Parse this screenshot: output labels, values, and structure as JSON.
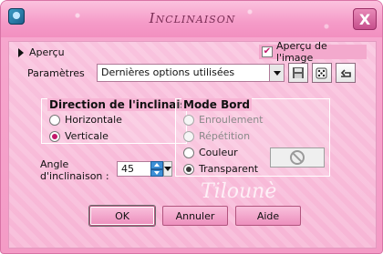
{
  "window": {
    "title": "Inclinaison",
    "close_label": "X"
  },
  "preview": {
    "toggle_label": "Aperçu",
    "checkbox_label": "Aperçu de l'image",
    "checkbox_checked": true
  },
  "parameters": {
    "label": "Paramètres",
    "preset_value": "Dernières options utilisées",
    "buttons": [
      "save-preset-icon",
      "dice-random-icon",
      "reset-icon"
    ]
  },
  "direction": {
    "title": "Direction de l'inclinais",
    "options": [
      {
        "label": "Horizontale",
        "selected": false
      },
      {
        "label": "Verticale",
        "selected": true
      }
    ]
  },
  "edge_mode": {
    "title": "Mode Bord",
    "options": [
      {
        "label": "Enroulement",
        "selected": false,
        "enabled": false
      },
      {
        "label": "Répétition",
        "selected": false,
        "enabled": false
      },
      {
        "label": "Couleur",
        "selected": false,
        "enabled": true
      },
      {
        "label": "Transparent",
        "selected": true,
        "enabled": true
      }
    ]
  },
  "angle": {
    "label_line1": "Angle",
    "label_line2": "d'inclinaison :",
    "value": "45"
  },
  "watermark_text": "Tilounè",
  "buttons": {
    "ok": "OK",
    "cancel": "Annuler",
    "help": "Aide"
  },
  "colors": {
    "dialog_background": "#f49bc6",
    "accent": "#c2186b"
  }
}
